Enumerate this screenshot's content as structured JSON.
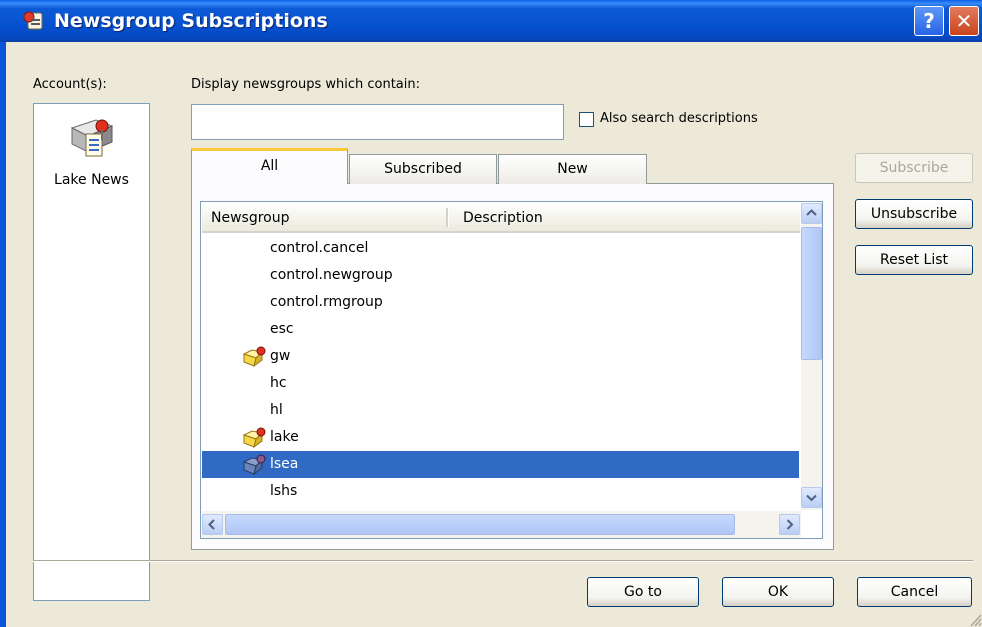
{
  "window": {
    "title": "Newsgroup Subscriptions",
    "help_label": "?",
    "close_label": "✕",
    "title_color": "#0651D0"
  },
  "accounts": {
    "label": "Account(s):",
    "items": [
      {
        "name": "Lake News",
        "icon": "news-server-icon"
      }
    ]
  },
  "search": {
    "label": "Display newsgroups which contain:",
    "value": "",
    "also_desc_label": "Also search descriptions",
    "also_desc_checked": false
  },
  "tabs": [
    {
      "label": "All",
      "active": true
    },
    {
      "label": "Subscribed",
      "active": false
    },
    {
      "label": "New",
      "active": false
    }
  ],
  "list": {
    "columns": [
      "Newsgroup",
      "Description"
    ],
    "rows": [
      {
        "name": "control.cancel",
        "subscribed": false,
        "selected": false
      },
      {
        "name": "control.newgroup",
        "subscribed": false,
        "selected": false
      },
      {
        "name": "control.rmgroup",
        "subscribed": false,
        "selected": false
      },
      {
        "name": "esc",
        "subscribed": false,
        "selected": false
      },
      {
        "name": "gw",
        "subscribed": true,
        "selected": false
      },
      {
        "name": "hc",
        "subscribed": false,
        "selected": false
      },
      {
        "name": "hl",
        "subscribed": false,
        "selected": false
      },
      {
        "name": "lake",
        "subscribed": true,
        "selected": false
      },
      {
        "name": "lsea",
        "subscribed": true,
        "selected": true
      },
      {
        "name": "lshs",
        "subscribed": false,
        "selected": false
      }
    ],
    "selection_color": "#316AC5"
  },
  "buttons": {
    "subscribe": "Subscribe",
    "unsubscribe": "Unsubscribe",
    "reset": "Reset List",
    "goto": "Go to",
    "ok": "OK",
    "cancel": "Cancel"
  }
}
